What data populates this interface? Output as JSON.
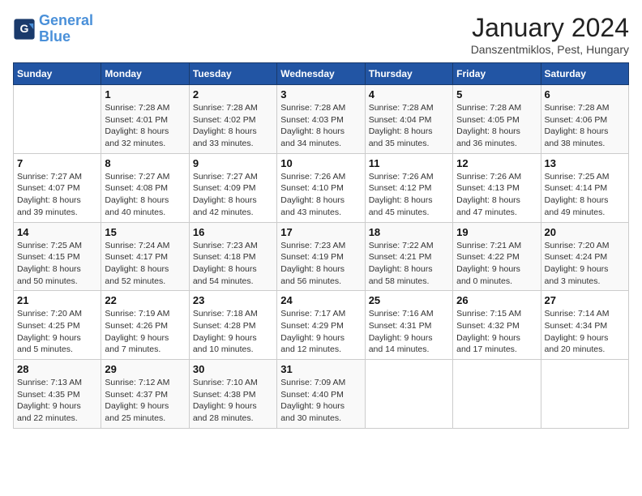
{
  "header": {
    "logo_line1": "General",
    "logo_line2": "Blue",
    "month": "January 2024",
    "location": "Danszentmiklos, Pest, Hungary"
  },
  "days_of_week": [
    "Sunday",
    "Monday",
    "Tuesday",
    "Wednesday",
    "Thursday",
    "Friday",
    "Saturday"
  ],
  "weeks": [
    [
      {
        "num": "",
        "info": ""
      },
      {
        "num": "1",
        "info": "Sunrise: 7:28 AM\nSunset: 4:01 PM\nDaylight: 8 hours\nand 32 minutes."
      },
      {
        "num": "2",
        "info": "Sunrise: 7:28 AM\nSunset: 4:02 PM\nDaylight: 8 hours\nand 33 minutes."
      },
      {
        "num": "3",
        "info": "Sunrise: 7:28 AM\nSunset: 4:03 PM\nDaylight: 8 hours\nand 34 minutes."
      },
      {
        "num": "4",
        "info": "Sunrise: 7:28 AM\nSunset: 4:04 PM\nDaylight: 8 hours\nand 35 minutes."
      },
      {
        "num": "5",
        "info": "Sunrise: 7:28 AM\nSunset: 4:05 PM\nDaylight: 8 hours\nand 36 minutes."
      },
      {
        "num": "6",
        "info": "Sunrise: 7:28 AM\nSunset: 4:06 PM\nDaylight: 8 hours\nand 38 minutes."
      }
    ],
    [
      {
        "num": "7",
        "info": "Sunrise: 7:27 AM\nSunset: 4:07 PM\nDaylight: 8 hours\nand 39 minutes."
      },
      {
        "num": "8",
        "info": "Sunrise: 7:27 AM\nSunset: 4:08 PM\nDaylight: 8 hours\nand 40 minutes."
      },
      {
        "num": "9",
        "info": "Sunrise: 7:27 AM\nSunset: 4:09 PM\nDaylight: 8 hours\nand 42 minutes."
      },
      {
        "num": "10",
        "info": "Sunrise: 7:26 AM\nSunset: 4:10 PM\nDaylight: 8 hours\nand 43 minutes."
      },
      {
        "num": "11",
        "info": "Sunrise: 7:26 AM\nSunset: 4:12 PM\nDaylight: 8 hours\nand 45 minutes."
      },
      {
        "num": "12",
        "info": "Sunrise: 7:26 AM\nSunset: 4:13 PM\nDaylight: 8 hours\nand 47 minutes."
      },
      {
        "num": "13",
        "info": "Sunrise: 7:25 AM\nSunset: 4:14 PM\nDaylight: 8 hours\nand 49 minutes."
      }
    ],
    [
      {
        "num": "14",
        "info": "Sunrise: 7:25 AM\nSunset: 4:15 PM\nDaylight: 8 hours\nand 50 minutes."
      },
      {
        "num": "15",
        "info": "Sunrise: 7:24 AM\nSunset: 4:17 PM\nDaylight: 8 hours\nand 52 minutes."
      },
      {
        "num": "16",
        "info": "Sunrise: 7:23 AM\nSunset: 4:18 PM\nDaylight: 8 hours\nand 54 minutes."
      },
      {
        "num": "17",
        "info": "Sunrise: 7:23 AM\nSunset: 4:19 PM\nDaylight: 8 hours\nand 56 minutes."
      },
      {
        "num": "18",
        "info": "Sunrise: 7:22 AM\nSunset: 4:21 PM\nDaylight: 8 hours\nand 58 minutes."
      },
      {
        "num": "19",
        "info": "Sunrise: 7:21 AM\nSunset: 4:22 PM\nDaylight: 9 hours\nand 0 minutes."
      },
      {
        "num": "20",
        "info": "Sunrise: 7:20 AM\nSunset: 4:24 PM\nDaylight: 9 hours\nand 3 minutes."
      }
    ],
    [
      {
        "num": "21",
        "info": "Sunrise: 7:20 AM\nSunset: 4:25 PM\nDaylight: 9 hours\nand 5 minutes."
      },
      {
        "num": "22",
        "info": "Sunrise: 7:19 AM\nSunset: 4:26 PM\nDaylight: 9 hours\nand 7 minutes."
      },
      {
        "num": "23",
        "info": "Sunrise: 7:18 AM\nSunset: 4:28 PM\nDaylight: 9 hours\nand 10 minutes."
      },
      {
        "num": "24",
        "info": "Sunrise: 7:17 AM\nSunset: 4:29 PM\nDaylight: 9 hours\nand 12 minutes."
      },
      {
        "num": "25",
        "info": "Sunrise: 7:16 AM\nSunset: 4:31 PM\nDaylight: 9 hours\nand 14 minutes."
      },
      {
        "num": "26",
        "info": "Sunrise: 7:15 AM\nSunset: 4:32 PM\nDaylight: 9 hours\nand 17 minutes."
      },
      {
        "num": "27",
        "info": "Sunrise: 7:14 AM\nSunset: 4:34 PM\nDaylight: 9 hours\nand 20 minutes."
      }
    ],
    [
      {
        "num": "28",
        "info": "Sunrise: 7:13 AM\nSunset: 4:35 PM\nDaylight: 9 hours\nand 22 minutes."
      },
      {
        "num": "29",
        "info": "Sunrise: 7:12 AM\nSunset: 4:37 PM\nDaylight: 9 hours\nand 25 minutes."
      },
      {
        "num": "30",
        "info": "Sunrise: 7:10 AM\nSunset: 4:38 PM\nDaylight: 9 hours\nand 28 minutes."
      },
      {
        "num": "31",
        "info": "Sunrise: 7:09 AM\nSunset: 4:40 PM\nDaylight: 9 hours\nand 30 minutes."
      },
      {
        "num": "",
        "info": ""
      },
      {
        "num": "",
        "info": ""
      },
      {
        "num": "",
        "info": ""
      }
    ]
  ]
}
